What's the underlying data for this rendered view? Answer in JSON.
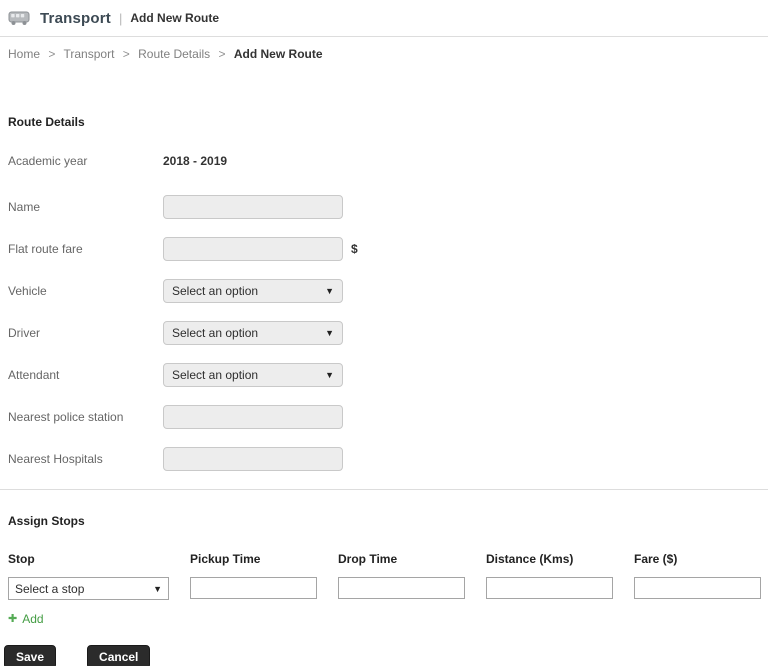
{
  "header": {
    "app_title": "Transport",
    "divider": "|",
    "page_title": "Add New Route"
  },
  "breadcrumb": {
    "separator": ">",
    "items": [
      "Home",
      "Transport",
      "Route Details"
    ],
    "current": "Add New Route"
  },
  "icons": {
    "dropdown_arrow": "▼",
    "plus": "✚"
  },
  "route_details": {
    "heading": "Route Details",
    "academic_year": {
      "label": "Academic year",
      "value": "2018 - 2019"
    },
    "name": {
      "label": "Name",
      "value": ""
    },
    "flat_route_fare": {
      "label": "Flat route fare",
      "value": "",
      "suffix": "$"
    },
    "vehicle": {
      "label": "Vehicle",
      "selected": "Select an option"
    },
    "driver": {
      "label": "Driver",
      "selected": "Select an option"
    },
    "attendant": {
      "label": "Attendant",
      "selected": "Select an option"
    },
    "nearest_police_station": {
      "label": "Nearest police station",
      "value": ""
    },
    "nearest_hospitals": {
      "label": "Nearest Hospitals",
      "value": ""
    }
  },
  "assign_stops": {
    "heading": "Assign Stops",
    "columns": [
      "Stop",
      "Pickup Time",
      "Drop Time",
      "Distance (Kms)",
      "Fare ($)"
    ],
    "stop_select": {
      "selected": "Select a stop"
    },
    "row_values": {
      "pickup_time": "",
      "drop_time": "",
      "distance": "",
      "fare": ""
    },
    "add_label": "Add"
  },
  "actions": {
    "save_label": "Save",
    "cancel_label": "Cancel"
  },
  "colors": {
    "accent_green": "#449d44",
    "button_dark": "#2b2b2b",
    "divider": "#dddddd",
    "input_gray_bg": "#ededed"
  }
}
